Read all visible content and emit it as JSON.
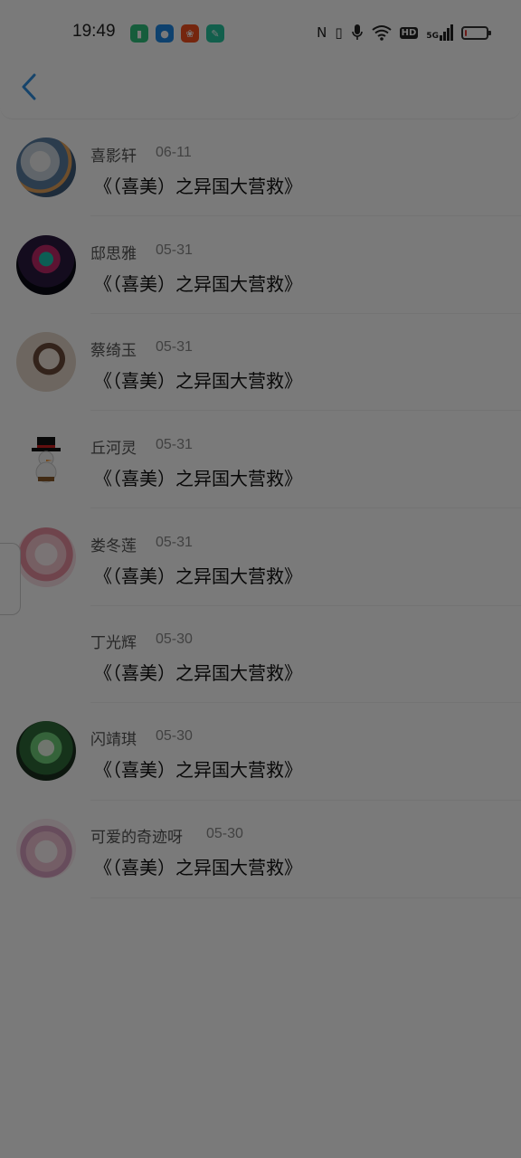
{
  "status_bar": {
    "time": "19:49",
    "icons": [
      "clipboard-app-icon",
      "browser-app-icon",
      "community-app-icon",
      "chat-app-icon"
    ],
    "nfc_symbol": "N",
    "vibrate_symbol": "▯",
    "mic_symbol": "🎙",
    "wifi_symbol": "📶",
    "hd_text": "HD",
    "network_text": "5G",
    "battery_level": 0.1
  },
  "nav": {
    "back_icon": "chevron-left-icon",
    "accent_color": "#2f8ee0"
  },
  "items": [
    {
      "name": "喜影轩",
      "date": "06-11",
      "title": "《（喜美）之异国大营救》",
      "has_avatar": true
    },
    {
      "name": "邸思雅",
      "date": "05-31",
      "title": "《（喜美）之异国大营救》",
      "has_avatar": true
    },
    {
      "name": "蔡绮玉",
      "date": "05-31",
      "title": "《（喜美）之异国大营救》",
      "has_avatar": true
    },
    {
      "name": "丘河灵",
      "date": "05-31",
      "title": "《（喜美）之异国大营救》",
      "has_avatar": true
    },
    {
      "name": "娄冬莲",
      "date": "05-31",
      "title": "《（喜美）之异国大营救》",
      "has_avatar": true
    },
    {
      "name": "丁光辉",
      "date": "05-30",
      "title": "《（喜美）之异国大营救》",
      "has_avatar": false
    },
    {
      "name": "闪靖琪",
      "date": "05-30",
      "title": "《（喜美）之异国大营救》",
      "has_avatar": true
    },
    {
      "name": "可爱的奇迹呀",
      "date": "05-30",
      "title": "《（喜美）之异国大营救》",
      "has_avatar": true
    }
  ]
}
